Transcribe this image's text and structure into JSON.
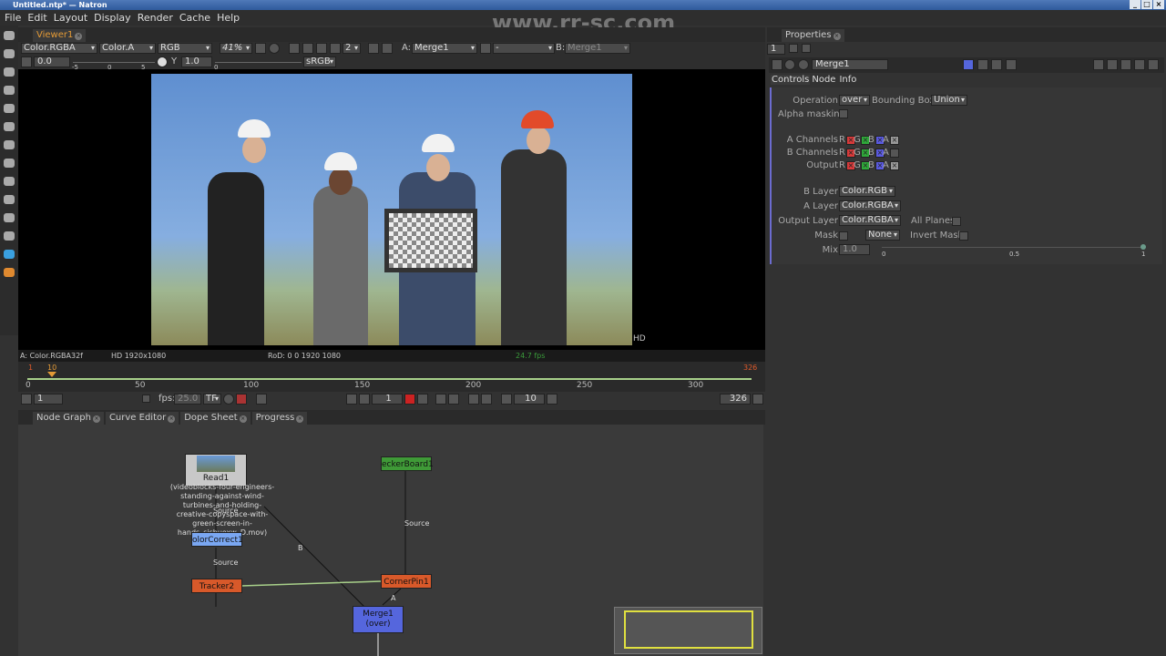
{
  "window": {
    "title": "Untitled.ntp* — Natron",
    "watermark": "www.rr-sc.com"
  },
  "menu": [
    "File",
    "Edit",
    "Layout",
    "Display",
    "Render",
    "Cache",
    "Help"
  ],
  "viewer": {
    "tab": "Viewer1",
    "layer": "Color.RGBA",
    "alpha": "Color.A",
    "display": "RGB",
    "zoom": "41%",
    "views": "2",
    "input_a": "A:",
    "input_a_value": "Merge1",
    "operator": "-",
    "input_b": "B:",
    "input_b_value": "Merge1",
    "gain": "0.0",
    "gain_ticks": [
      "-5",
      "0",
      "5"
    ],
    "gamma_label": "Y",
    "gamma": "1.0",
    "gamma_tick": "0",
    "colorspace": "sRGB",
    "format_badge": "HD",
    "info": {
      "channels": "A: Color.RGBA32f",
      "format": "HD 1920x1080",
      "rod": "RoD: 0 0 1920 1080",
      "fps": "24.7 fps"
    }
  },
  "timeline": {
    "ticks": [
      "0",
      "50",
      "100",
      "150",
      "200",
      "250",
      "300"
    ],
    "start_marker": "1",
    "current_marker": "10",
    "end_marker": "326",
    "first_frame": "1",
    "fps_label": "fps:",
    "fps": "25.0",
    "tf": "TF",
    "current_frame": "1",
    "increment": "10",
    "last_frame": "326"
  },
  "nodegraph": {
    "tabs": [
      "Node Graph",
      "Curve Editor",
      "Dope Sheet",
      "Progress"
    ],
    "nodes": {
      "read": {
        "name": "Read1",
        "file": "(videoblocks-four-engineers-standing-against-wind-turbines-and-holding-creative-copyspace-with-green-screen-in-hands_sisbuoxw_D.mov)"
      },
      "checker": "eckerBoard1",
      "colorcorrect": "olorCorrect1",
      "tracker": "Tracker2",
      "cornerpin": "CornerPin1",
      "merge": "Merge1",
      "merge_op": "(over)"
    },
    "edge_labels": {
      "source1": "Source",
      "source2": "Source",
      "source3": "Source",
      "b": "B",
      "a": "A"
    }
  },
  "properties": {
    "tab": "Properties",
    "max_panels": "1",
    "node_name": "Merge1",
    "subtabs": [
      "Controls",
      "Node",
      "Info"
    ],
    "operation_label": "Operation",
    "operation": "over",
    "bbox_label": "Bounding Box",
    "bbox": "Union",
    "alpha_masking": "Alpha masking",
    "channels": [
      {
        "label": "A Channels",
        "a_checked": true
      },
      {
        "label": "B Channels",
        "a_checked": false
      },
      {
        "label": "Output",
        "a_checked": true
      }
    ],
    "channel_letters": [
      "R",
      "G",
      "B",
      "A"
    ],
    "b_layer_label": "B Layer",
    "b_layer": "Color.RGB",
    "a_layer_label": "A Layer",
    "a_layer": "Color.RGBA",
    "output_layer_label": "Output Layer",
    "output_layer": "Color.RGBA",
    "all_planes": "All Planes",
    "mask_label": "Mask",
    "mask": "None",
    "invert_mask": "Invert Mask",
    "mix_label": "Mix",
    "mix": "1.0",
    "mix_ticks": [
      "0",
      "0.5",
      "1"
    ]
  },
  "colors": {
    "accent": "#e39a36",
    "merge_node": "#5566dd",
    "tracker_node": "#d8592a",
    "checker_node": "#3f9a37",
    "colorcorrect_node": "#7aa7f2"
  }
}
